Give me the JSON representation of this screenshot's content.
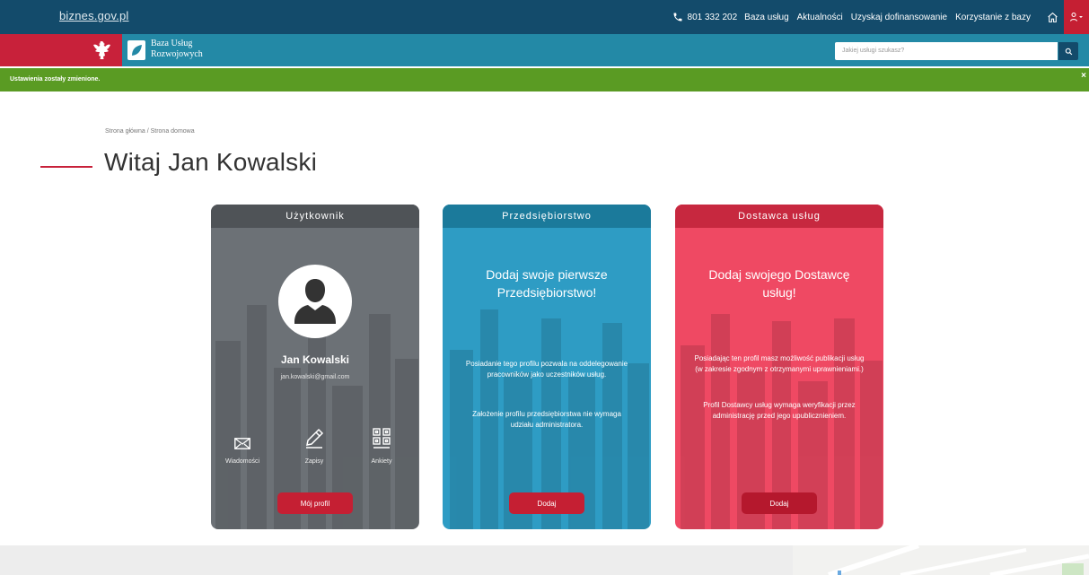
{
  "topbar": {
    "brand": "biznes.gov.pl",
    "phone": "801 332 202",
    "links": [
      "Baza usług",
      "Aktualności",
      "Uzyskaj dofinansowanie",
      "Korzystanie z bazy"
    ]
  },
  "header": {
    "logo_line1": "Baza Usług",
    "logo_line2": "Rozwojowych",
    "search_placeholder": "Jakiej usługi szukasz?"
  },
  "notice": {
    "text": "Ustawienia zostały zmienione."
  },
  "page": {
    "breadcrumb": "Strona główna / Strona domowa",
    "title": "Witaj Jan Kowalski"
  },
  "cards": {
    "user": {
      "header": "Użytkownik",
      "name": "Jan Kowalski",
      "email": "jan.kowalski@gmail.com",
      "actions": [
        "Wiadomości",
        "Zapisy",
        "Ankiety"
      ],
      "button": "Mój profil"
    },
    "firm": {
      "header": "Przedsiębiorstwo",
      "heading": "Dodaj swoje pierwsze Przedsiębiorstwo!",
      "text1": "Posiadanie tego profilu pozwala na oddelegowanie pracowników jako uczestników usług.",
      "text2": "Założenie profilu przedsiębiorstwa nie wymaga udziału administratora.",
      "button": "Dodaj"
    },
    "provider": {
      "header": "Dostawca usług",
      "heading": "Dodaj swojego Dostawcę usług!",
      "text1": "Posiadając ten profil masz możliwość publikacji usług (w zakresie zgodnym z otrzymanymi uprawnieniami.)",
      "text2": "Profil Dostawcy usług wymaga weryfikacji przez administrację przed jego upublicznieniem.",
      "button": "Dodaj"
    }
  }
}
